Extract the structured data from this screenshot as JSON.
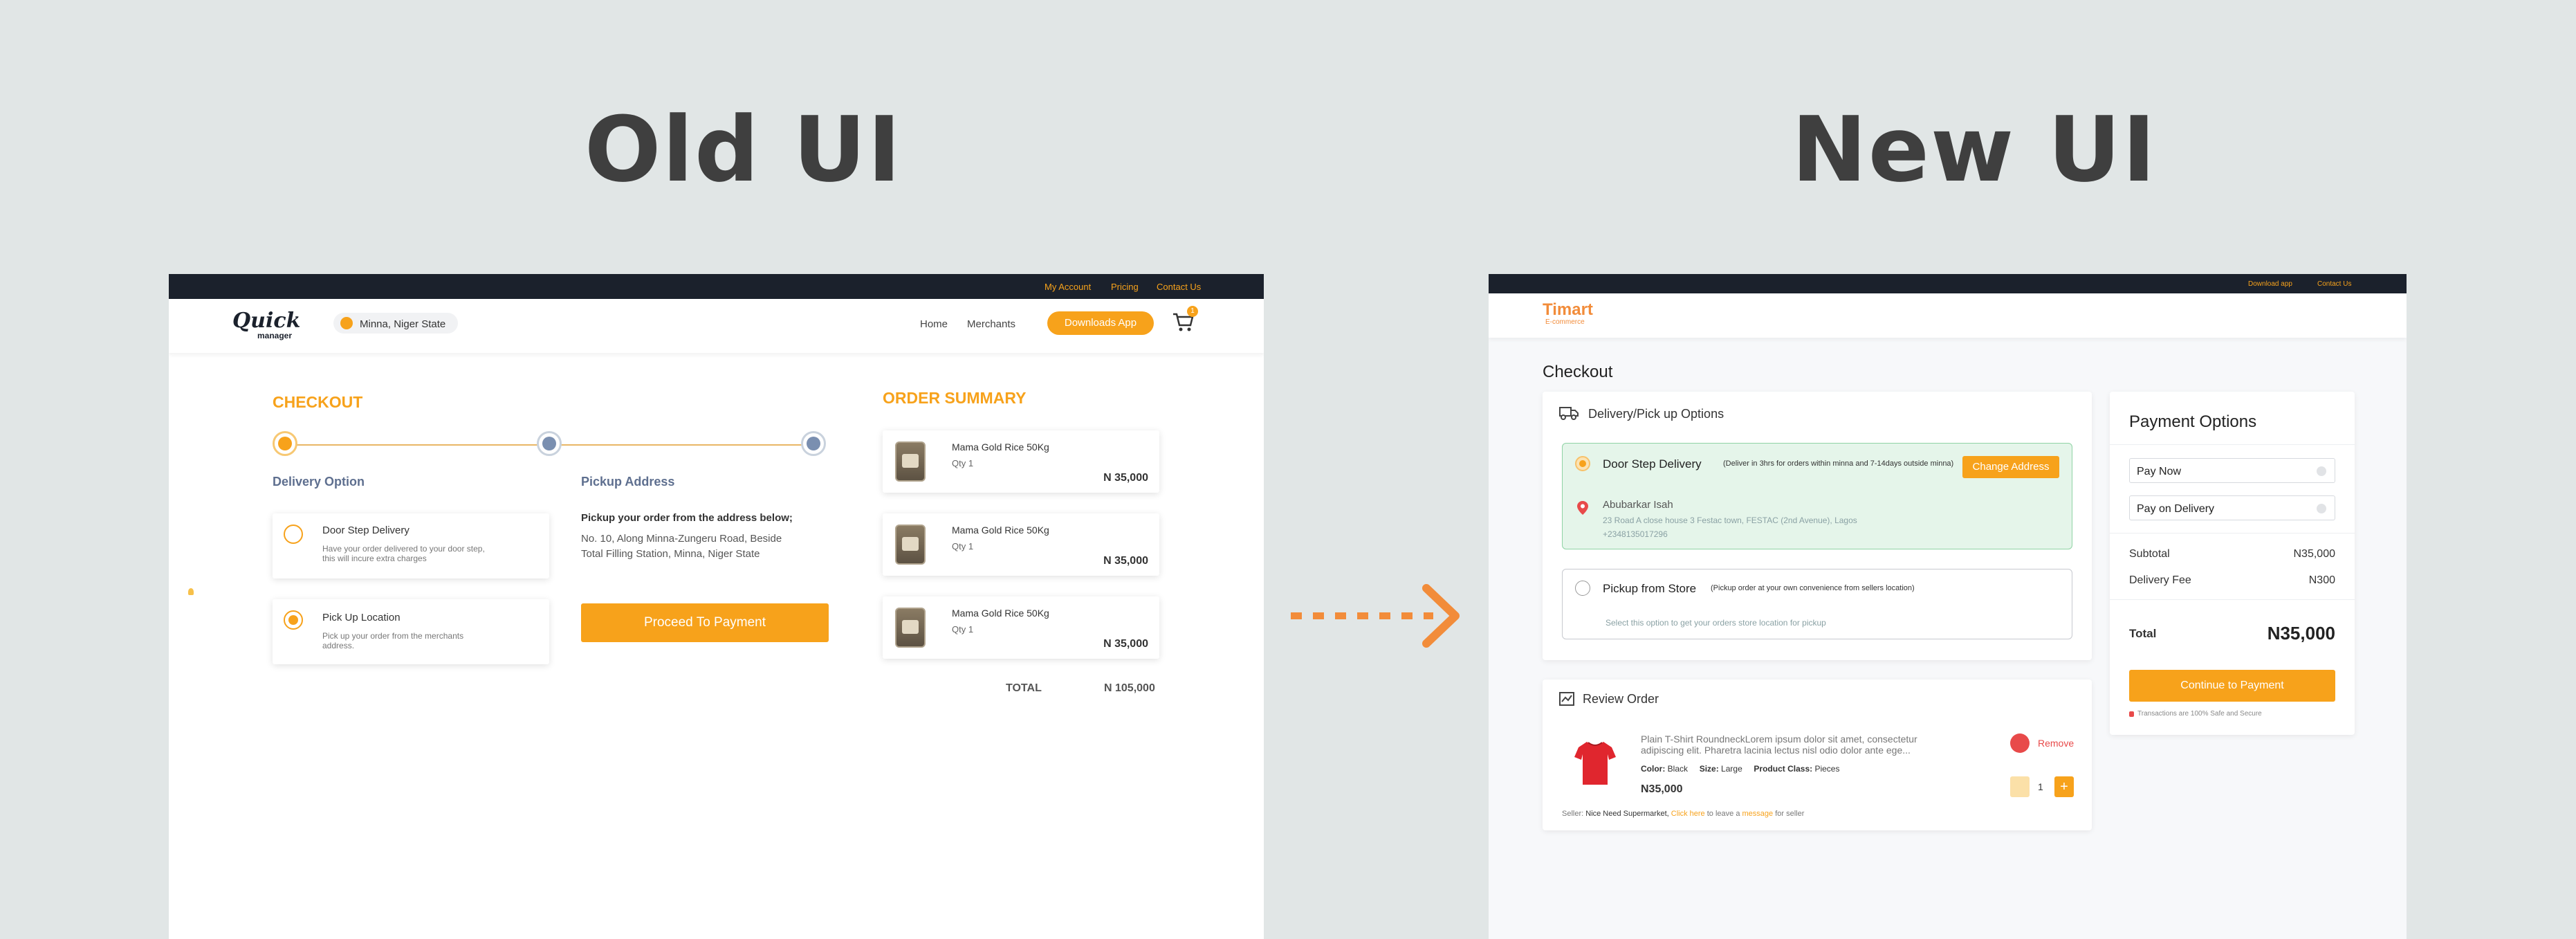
{
  "headings": {
    "old": "Old UI",
    "new": "New UI"
  },
  "old_ui": {
    "top_links": [
      "My Account",
      "Pricing",
      "Contact Us"
    ],
    "logo": {
      "top": "Quick",
      "bottom": "manager"
    },
    "location": "Minna, Niger State",
    "nav": {
      "home": "Home",
      "merchants": "Merchants",
      "download": "Downloads App"
    },
    "cart_count": "1",
    "checkout_title": "CHECKOUT",
    "delivery_option_title": "Delivery Option",
    "pickup_address_title": "Pickup Address",
    "options": [
      {
        "title": "Door Step Delivery",
        "desc": "Have your order delivered to your door step, this will incure extra charges",
        "selected": false
      },
      {
        "title": "Pick Up Location",
        "desc": "Pick up your order from the merchants address.",
        "selected": true
      }
    ],
    "pickup_intro": "Pickup your order from the address below;",
    "pickup_address_line1": "No. 10, Along Minna-Zungeru Road, Beside",
    "pickup_address_line2": "Total Filling Station, Minna, Niger State",
    "proceed_button": "Proceed To Payment",
    "order_summary_title": "ORDER SUMMARY",
    "items": [
      {
        "name": "Mama Gold Rice 50Kg",
        "qty": "Qty 1",
        "price": "N 35,000"
      },
      {
        "name": "Mama Gold Rice 50Kg",
        "qty": "Qty 1",
        "price": "N 35,000"
      },
      {
        "name": "Mama Gold Rice 50Kg",
        "qty": "Qty 1",
        "price": "N 35,000"
      }
    ],
    "total_label": "TOTAL",
    "total_value": "N 105,000"
  },
  "new_ui": {
    "top_links": [
      "Download app",
      "Contact Us"
    ],
    "logo": {
      "name": "Timart",
      "sub": "E-commerce"
    },
    "checkout_title": "Checkout",
    "delivery_section_title": "Delivery/Pick up Options",
    "door_step": {
      "title": "Door Step Delivery",
      "note": "(Deliver in 3hrs for orders within minna and 7-14days outside minna)",
      "change_button": "Change Address",
      "name": "Abubarkar Isah",
      "address": "23 Road A close house 3 Festac town, FESTAC (2nd Avenue), Lagos",
      "phone": "+2348135017296"
    },
    "pickup": {
      "title": "Pickup from Store",
      "note": "(Pickup order at your own convenience from sellers location)",
      "hint": "Select this option to get your orders store location for pickup"
    },
    "review_title": "Review Order",
    "product": {
      "name": "Plain T-Shirt RoundneckLorem ipsum dolor sit amet, consectetur adipiscing elit. Pharetra lacinia lectus nisl odio dolor ante ege...",
      "color_label": "Color:",
      "color": "Black",
      "size_label": "Size:",
      "size": "Large",
      "class_label": "Product Class:",
      "class": "Pieces",
      "price": "N35,000",
      "remove": "Remove",
      "qty": "1",
      "seller_label": "Seller:",
      "seller": "Nice Need Supermarket,",
      "click_here": "Click here",
      "to_leave": "to leave a",
      "message": "message",
      "for_seller": "for seller"
    },
    "payment": {
      "title": "Payment Options",
      "options": [
        "Pay Now",
        "Pay on Delivery"
      ],
      "subtotal_label": "Subtotal",
      "subtotal": "N35,000",
      "delivery_label": "Delivery Fee",
      "delivery": "N300",
      "total_label": "Total",
      "total": "N35,000",
      "continue_button": "Continue to Payment",
      "secure_note": "Transactions are 100% Safe and Secure"
    }
  },
  "colors": {
    "accent": "#f7a21b",
    "dark_bar": "#1b212c",
    "green_bg": "#e5f5ea",
    "green_border": "#8fd3a4",
    "blue_step": "#7a8fb0",
    "remove_red": "#e84a4a"
  }
}
